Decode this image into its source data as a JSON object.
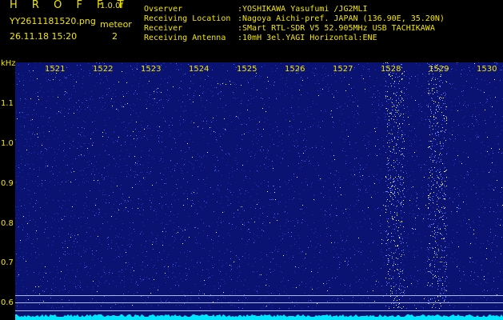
{
  "header": {
    "logo": "H R O F F T",
    "version": "1.0.0f",
    "file_name": "YY2611181520.png",
    "timestamp": "26.11.18 15:20",
    "meteor_label": "meteor",
    "meteor_count": "2"
  },
  "meta": [
    {
      "key": "Ovserver",
      "value": ":YOSHIKAWA Yasufumi /JG2MLI"
    },
    {
      "key": "Receiving Location",
      "value": ":Nagoya Aichi-pref. JAPAN (136.90E, 35.20N)"
    },
    {
      "key": "Receiver",
      "value": ":SMart RTL-SDR V5 52.905MHz USB TACHIKAWA"
    },
    {
      "key": "Receiving Antenna",
      "value": ":10mH 3el.YAGI Horizontal:ENE"
    }
  ],
  "axes": {
    "y_unit": "kHz",
    "y_ticks": [
      "1.1",
      "1.0",
      "0.9",
      "0.8",
      "0.7",
      "0.6"
    ],
    "x_ticks": [
      "1521",
      "1522",
      "1523",
      "1524",
      "1525",
      "1526",
      "1527",
      "1528",
      "1529",
      "1530"
    ]
  },
  "colors": {
    "background": "#000000",
    "text": "#f2e600",
    "spectrogram": "#0a1372",
    "noise_floor": "#00e5ff"
  }
}
